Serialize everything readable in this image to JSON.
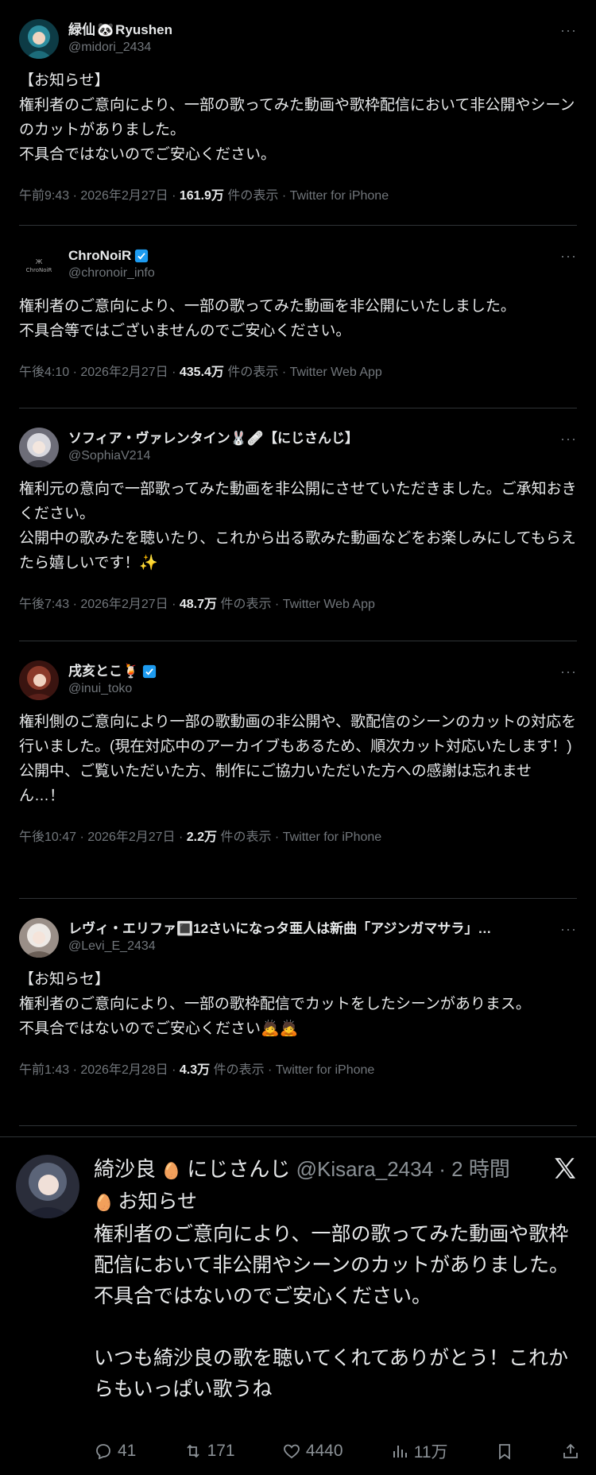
{
  "tweets": [
    {
      "name": "緑仙",
      "name_suffix": "Ryushen",
      "handle": "@midori_2434",
      "verified": false,
      "avatar_colors": [
        "#2e8fa0",
        "#0d3b45"
      ],
      "body": "【お知らせ】\n権利者のご意向により、一部の歌ってみた動画や歌枠配信において非公開やシーンのカットがありました。\n不具合ではないのでご安心ください。",
      "time": "午前9:43 · 2026年2月27日 · ",
      "views": "161.9万",
      "views_suffix": " 件の表示 · Twitter for iPhone"
    },
    {
      "name": "ChroNoiR",
      "name_suffix": "",
      "handle": "@chronoir_info",
      "verified": true,
      "avatar_colors": [
        "#111111",
        "#222222"
      ],
      "body": "権利者のご意向により、一部の歌ってみた動画を非公開にいたしました。\n不具合等ではございませんのでご安心ください。",
      "time": "午後4:10 · 2026年2月27日 · ",
      "views": "435.4万",
      "views_suffix": " 件の表示 · Twitter Web App"
    },
    {
      "name": "ソフィア・ヴァレンタイン🐰🩹【にじさんじ】",
      "name_suffix": "",
      "handle": "@SophiaV214",
      "verified": false,
      "avatar_colors": [
        "#c9c9cf",
        "#6d6d78"
      ],
      "body": "権利元の意向で一部歌ってみた動画を非公開にさせていただきました。ご承知おきください。\n公開中の歌みたを聴いたり、これから出る歌みた動画などをお楽しみにしてもらえたら嬉しいです！✨",
      "time": "午後7:43 · 2026年2月27日 · ",
      "views": "48.7万",
      "views_suffix": " 件の表示 · Twitter Web App"
    },
    {
      "name": "戌亥とこ🍹",
      "name_suffix": "",
      "handle": "@inui_toko",
      "verified": true,
      "avatar_colors": [
        "#8b3a2a",
        "#3a1410"
      ],
      "body": "権利側のご意向により一部の歌動画の非公開や、歌配信のシーンのカットの対応を行いました。(現在対応中のアーカイブもあるため、順次カット対応いたします！)\n公開中、ご覧いただいた方、制作にご協力いただいた方への感謝は忘れません…！",
      "time": "午後10:47 · 2026年2月27日 · ",
      "views": "2.2万",
      "views_suffix": " 件の表示 · Twitter for iPhone"
    },
    {
      "name": "レヴィ・エリファ🔳12さいになっタ亜人は新曲「アジンガマサラ」…",
      "name_suffix": "",
      "handle": "@Levi_E_2434",
      "verified": false,
      "avatar_colors": [
        "#e0dcd8",
        "#9a8f88"
      ],
      "body": "【お知らセ】\n権利者のご意向により、一部の歌枠配信でカットをしたシーンがありまス。\n不具合ではないのでご安心ください🙇🙇",
      "time": "午前1:43 · 2026年2月28日 · ",
      "views": "4.3万",
      "views_suffix": " 件の表示 · Twitter for iPhone"
    }
  ],
  "card": {
    "name": "綺沙良",
    "badge": "にじさんじ",
    "handle": "@Kisara_2434",
    "time": "· 2 時間",
    "body": "お知らせ\n権利者のご意向により、一部の歌ってみた動画や歌枠配信において非公開やシーンのカットがありました。\n不具合ではないのでご安心ください。\n\nいつも綺沙良の歌を聴いてくれてありがとう！これからもいっぱい歌うね",
    "replies": "41",
    "retweets": "171",
    "likes": "4440",
    "views": "11万"
  },
  "more_label": "···",
  "accent": "#1d9bf0"
}
